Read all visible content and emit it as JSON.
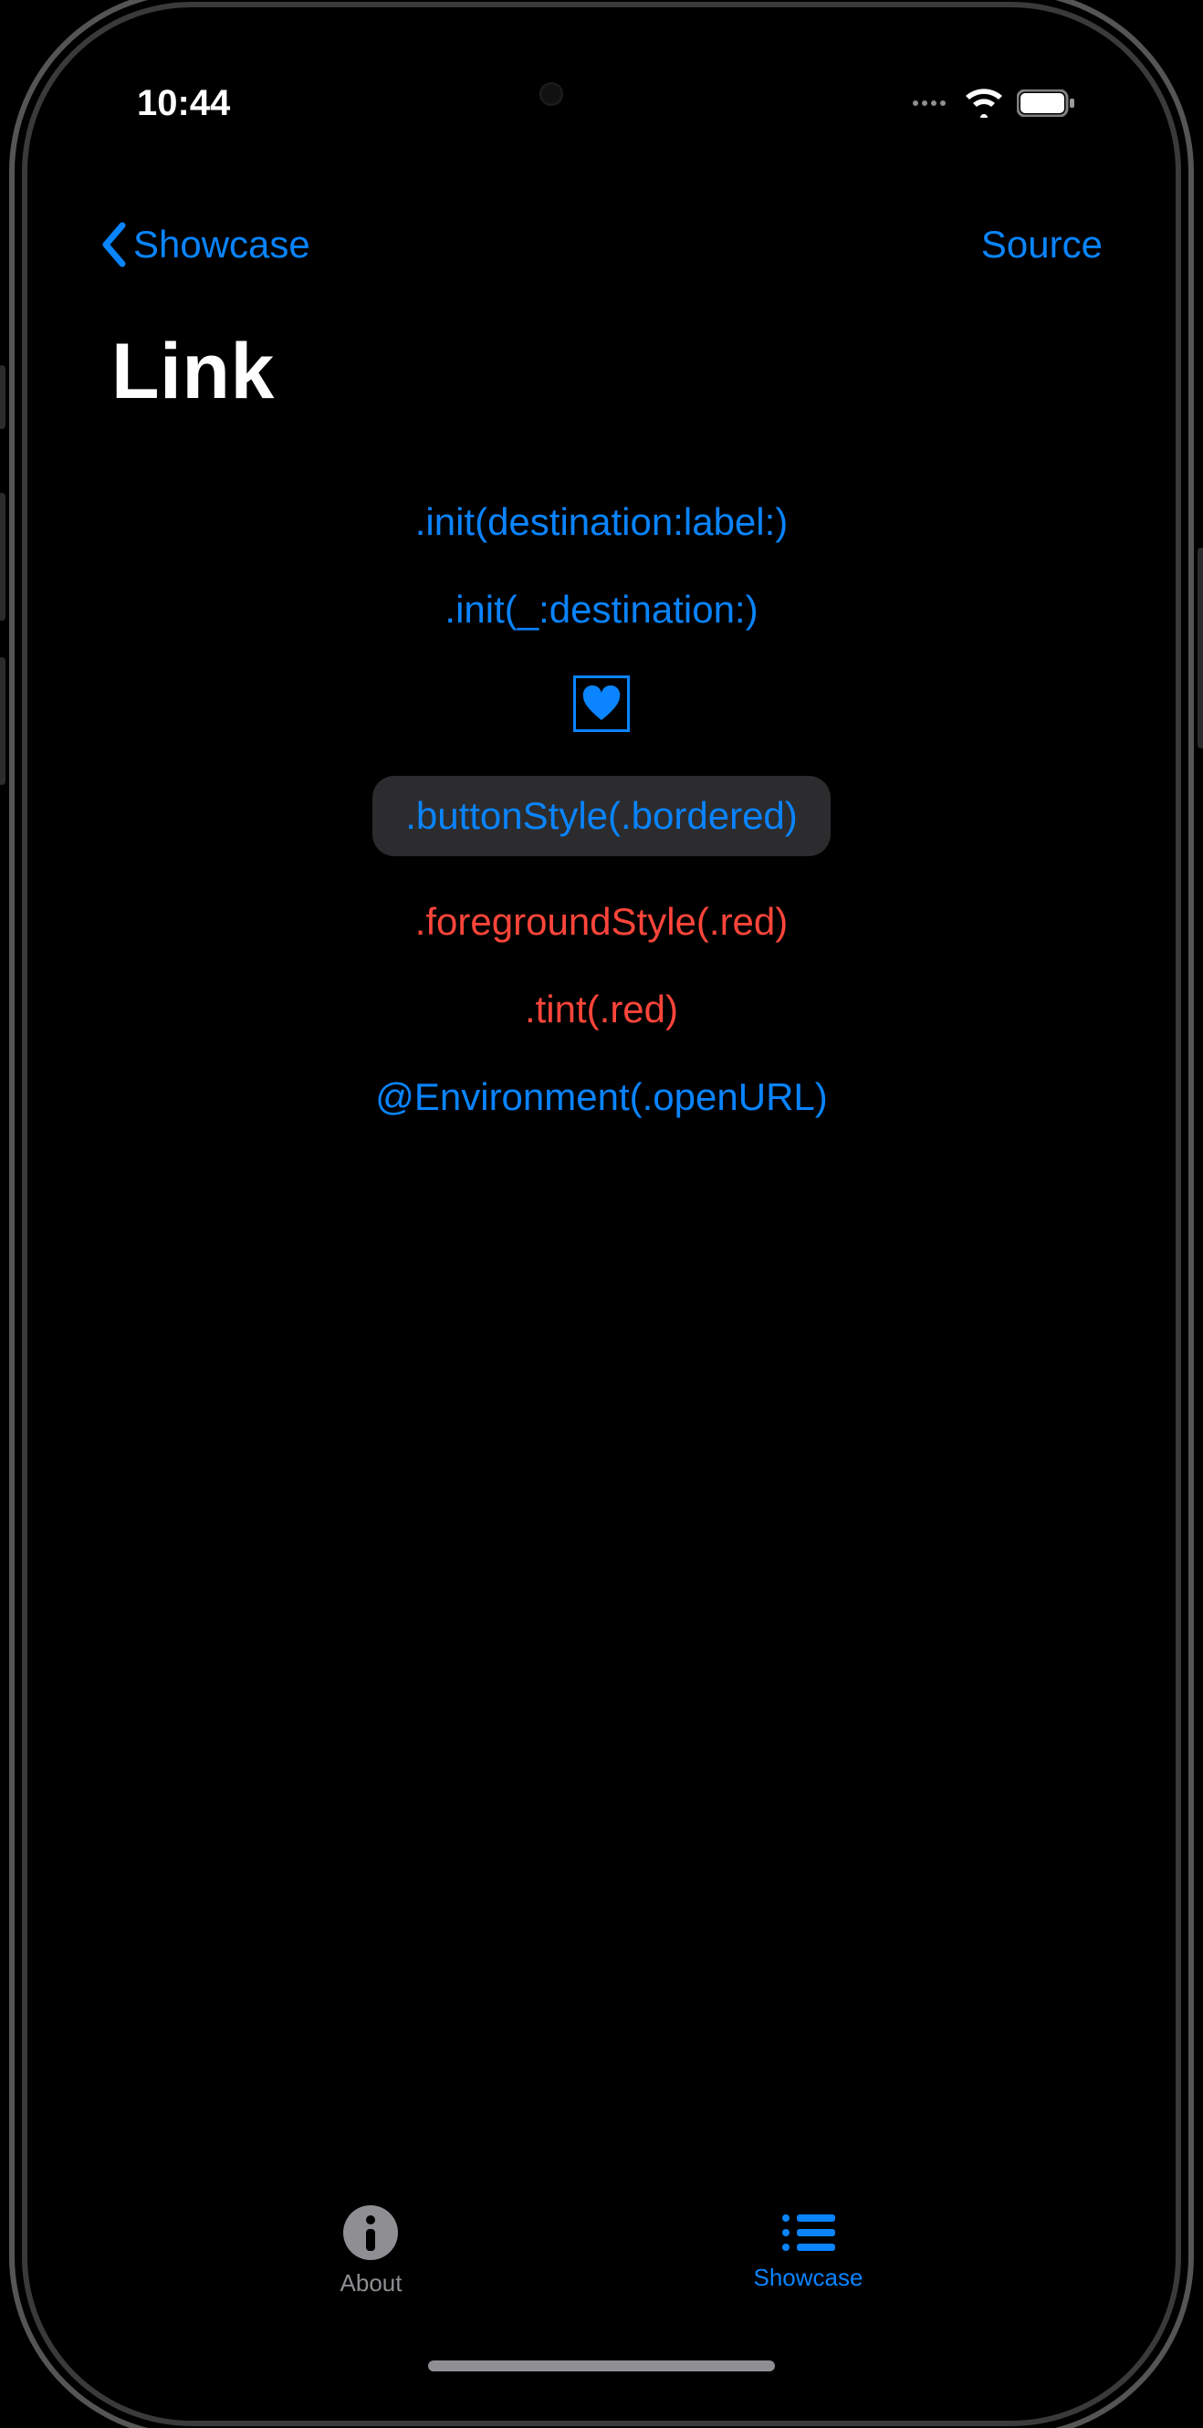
{
  "status": {
    "time": "10:44"
  },
  "nav": {
    "back_label": "Showcase",
    "right_label": "Source",
    "title": "Link"
  },
  "links": {
    "init_destination_label": ".init(destination:label:)",
    "init_unnamed_destination": ".init(_:destination:)",
    "button_style_bordered": ".buttonStyle(.bordered)",
    "foreground_style_red": ".foregroundStyle(.red)",
    "tint_red": ".tint(.red)",
    "environment_open_url": "@Environment(.openURL)"
  },
  "tabs": {
    "about_label": "About",
    "showcase_label": "Showcase"
  },
  "colors": {
    "accent": "#0a84ff",
    "red": "#ff453a",
    "inactive": "#8e8e93",
    "bordered_bg": "#2c2c2e"
  }
}
